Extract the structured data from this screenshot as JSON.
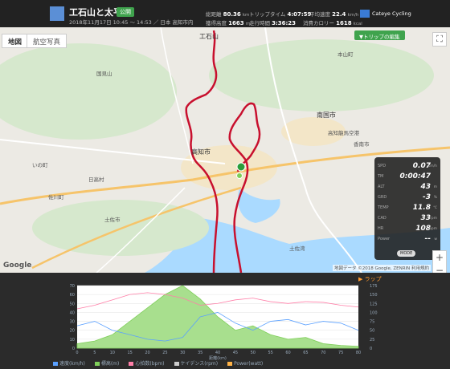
{
  "header": {
    "title": "工石山と太平洋",
    "badge": "公開",
    "subtitle": "2018年11月17日 10:45 〜 14:53 ／ 日本 高知市内",
    "stats": [
      {
        "label": "総距離",
        "value": "80.36",
        "unit": "km"
      },
      {
        "label": "トリップタイム",
        "value": "4:07:59",
        "unit": ""
      },
      {
        "label": "平均速度",
        "value": "22.4",
        "unit": "km/h"
      },
      {
        "label": "獲得高度",
        "value": "1663",
        "unit": "m"
      },
      {
        "label": "走行時間",
        "value": "3:36:23",
        "unit": ""
      },
      {
        "label": "消費カロリー",
        "value": "1618",
        "unit": "kcal"
      }
    ],
    "brand": "Cateye Cycling"
  },
  "map": {
    "tabs": [
      "地図",
      "航空写真"
    ],
    "trip_edit": "▼トリップの編集",
    "zoom_in": "+",
    "zoom_out": "−",
    "fullscreen": "⛶",
    "google": "Google",
    "attribution": "地図データ ©2018 Google, ZENRIN  利用規約",
    "places": [
      {
        "name": "工石山"
      },
      {
        "name": "国見山"
      },
      {
        "name": "本山町"
      },
      {
        "name": "高知市"
      },
      {
        "name": "南国市"
      },
      {
        "name": "土佐市"
      },
      {
        "name": "香南市"
      },
      {
        "name": "いの町"
      },
      {
        "name": "佐川町"
      },
      {
        "name": "日高村"
      },
      {
        "name": "高知龍馬空港"
      },
      {
        "name": "土佐湾"
      }
    ],
    "route_color": "#c8102e"
  },
  "cyclo": {
    "rows": [
      {
        "label": "SPD",
        "value": "0.07",
        "unit": "km/h"
      },
      {
        "label": "TM",
        "value": "0:00:47",
        "unit": ""
      },
      {
        "label": "ALT",
        "value": "43",
        "unit": "m"
      },
      {
        "label": "GRD",
        "value": "-3",
        "unit": "%"
      },
      {
        "label": "TEMP",
        "value": "11.8",
        "unit": "℃"
      },
      {
        "label": "CAD",
        "value": "33",
        "unit": "rpm"
      },
      {
        "label": "HR",
        "value": "108",
        "unit": "bpm"
      },
      {
        "label": "Power",
        "value": "--",
        "unit": "w"
      }
    ],
    "mode": "MODE"
  },
  "chart": {
    "lap_label": "ラップ",
    "xlabel": "距離(km)",
    "x_ticks": [
      "0",
      "5",
      "10",
      "15",
      "20",
      "25",
      "30",
      "35",
      "40",
      "45",
      "50",
      "55",
      "60",
      "65",
      "70",
      "75",
      "80"
    ],
    "y_left_ticks": [
      "0",
      "10",
      "20",
      "30",
      "40",
      "50",
      "60",
      "70"
    ],
    "y_right_ticks": [
      "0",
      "25",
      "50",
      "75",
      "100",
      "125",
      "150",
      "175"
    ],
    "legend": [
      {
        "label": "速度(km/h)",
        "color": "#5aa0ff"
      },
      {
        "label": "標高(m)",
        "color": "#7fcf5a"
      },
      {
        "label": "心拍数(bpm)",
        "color": "#ff7fa8"
      },
      {
        "label": "ケイデンス(rpm)",
        "color": "#cccccc"
      },
      {
        "label": "Power(watt)",
        "color": "#ffb347"
      }
    ]
  },
  "chart_data": {
    "type": "line",
    "xlabel": "距離(km)",
    "xlim": [
      0,
      80
    ],
    "ylim": [
      0,
      70
    ],
    "x": [
      0,
      5,
      10,
      15,
      20,
      25,
      30,
      35,
      40,
      45,
      50,
      55,
      60,
      65,
      70,
      75,
      80
    ],
    "series": [
      {
        "name": "標高(m)",
        "values": [
          5,
          8,
          15,
          30,
          45,
          60,
          70,
          55,
          35,
          20,
          25,
          15,
          10,
          12,
          5,
          3,
          2
        ]
      },
      {
        "name": "速度(km/h)",
        "values": [
          25,
          30,
          20,
          15,
          10,
          8,
          12,
          35,
          40,
          28,
          20,
          30,
          32,
          26,
          30,
          28,
          20
        ]
      },
      {
        "name": "心拍数(bpm)",
        "values": [
          110,
          120,
          135,
          150,
          155,
          150,
          140,
          120,
          125,
          135,
          140,
          130,
          125,
          130,
          128,
          120,
          115
        ]
      }
    ]
  }
}
